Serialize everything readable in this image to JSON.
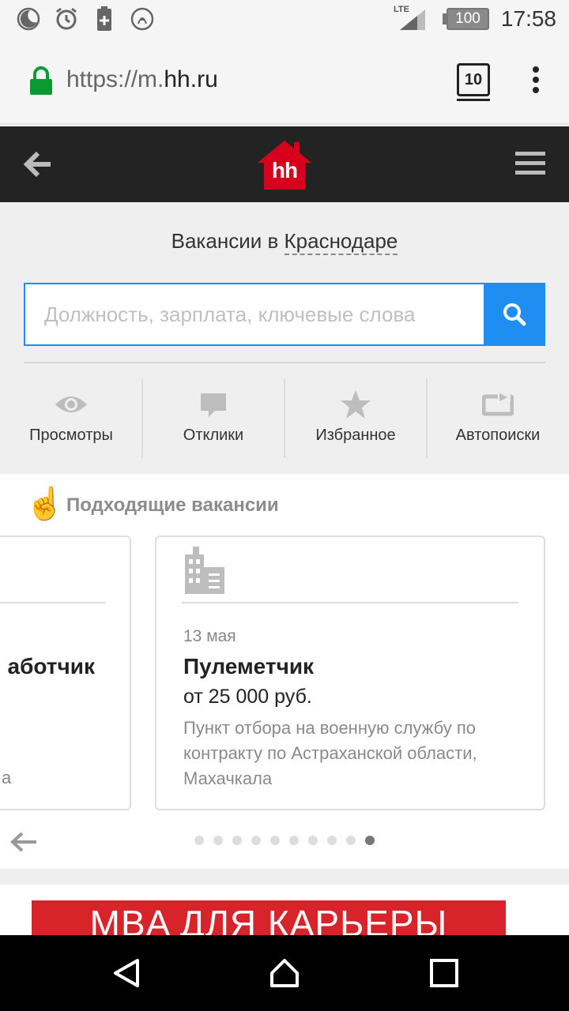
{
  "status_bar": {
    "network": "LTE",
    "battery": "100",
    "time": "17:58"
  },
  "browser": {
    "url_prefix": "https://m.",
    "url_domain": "hh.ru",
    "tab_count": "10"
  },
  "site": {
    "logo_text": "hh",
    "brand_color": "#d6001c"
  },
  "search": {
    "headline_prefix": "Вакансии в ",
    "city": "Краснодаре",
    "placeholder": "Должность, зарплата, ключевые слова",
    "accent_color": "#1e8ef3"
  },
  "quick_links": [
    {
      "label": "Просмотры",
      "icon": "eye-icon"
    },
    {
      "label": "Отклики",
      "icon": "speech-bubble-icon"
    },
    {
      "label": "Избранное",
      "icon": "star-icon"
    },
    {
      "label": "Автопоиски",
      "icon": "repeat-icon"
    }
  ],
  "recommended": {
    "title": "Подходящие вакансии",
    "left_card": {
      "title_fragment": "аботчик",
      "city_fragment": "а"
    },
    "main_card": {
      "date": "13 мая",
      "title": "Пулеметчик",
      "salary": "от 25 000 руб.",
      "company": "Пункт отбора на военную службу по контракту по Астраханской области, Махачкала"
    },
    "pages_total": 10,
    "active_page": 10
  },
  "banner": {
    "text": "MBA ДЛЯ КАРЬЕРЫ"
  }
}
